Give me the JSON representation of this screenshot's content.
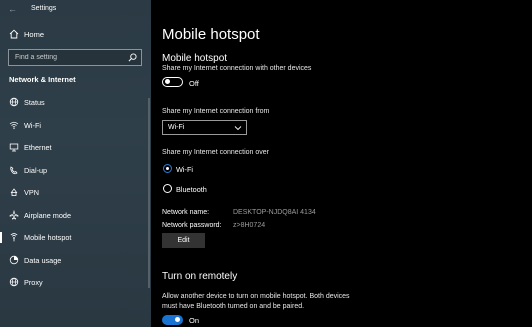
{
  "window": {
    "title": "Settings"
  },
  "sidebar": {
    "home_label": "Home",
    "search_placeholder": "Find a setting",
    "section_title": "Network & Internet",
    "items": [
      {
        "label": "Status",
        "icon": "home-globe-icon"
      },
      {
        "label": "Wi-Fi",
        "icon": "wifi-icon"
      },
      {
        "label": "Ethernet",
        "icon": "ethernet-icon"
      },
      {
        "label": "Dial-up",
        "icon": "dialup-icon"
      },
      {
        "label": "VPN",
        "icon": "vpn-icon"
      },
      {
        "label": "Airplane mode",
        "icon": "airplane-icon"
      },
      {
        "label": "Mobile hotspot",
        "icon": "hotspot-icon",
        "active": true
      },
      {
        "label": "Data usage",
        "icon": "data-usage-icon"
      },
      {
        "label": "Proxy",
        "icon": "globe-icon"
      }
    ]
  },
  "main": {
    "page_title": "Mobile hotspot",
    "hotspot": {
      "heading": "Mobile hotspot",
      "desc": "Share my Internet connection with other devices",
      "toggle_label": "Off",
      "toggle_on": false
    },
    "share_from": {
      "label": "Share my Internet connection from",
      "selected": "Wi-Fi"
    },
    "share_over": {
      "label": "Share my Internet connection over",
      "options": [
        "Wi-Fi",
        "Bluetooth"
      ],
      "selected": "Wi-Fi"
    },
    "network": {
      "name_key": "Network name:",
      "name_val": "DESKTOP-NJDQ8AI 4134",
      "password_key": "Network password:",
      "password_val": "z>8H0724",
      "edit_label": "Edit"
    },
    "remote": {
      "heading": "Turn on remotely",
      "desc_line1": "Allow another device to turn on mobile hotspot. Both devices",
      "desc_line2": "must have Bluetooth turned on and be paired.",
      "toggle_label": "On",
      "toggle_on": true
    }
  },
  "colors": {
    "accent": "#1a73d1",
    "sidebar_bg": "#2f3f49",
    "main_bg": "#000000",
    "muted_text": "#9c9c9c"
  }
}
